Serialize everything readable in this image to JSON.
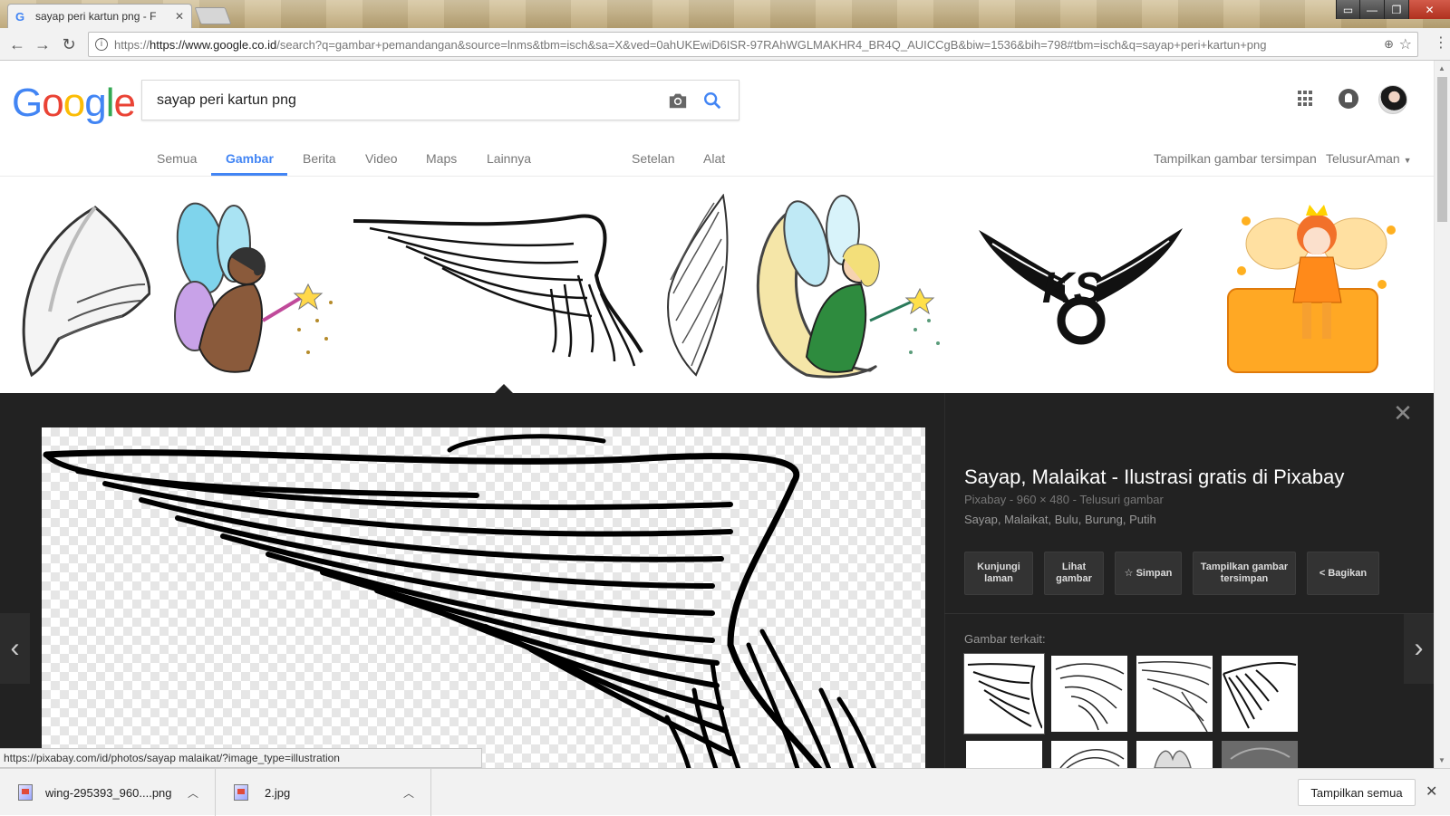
{
  "browser": {
    "tab_title": "sayap peri kartun png - F",
    "url_host": "https://www.google.co.id",
    "url_rest": "/search?q=gambar+pemandangan&source=lnms&tbm=isch&sa=X&ved=0ahUKEwiD6ISR-97RAhWGLMAKHR4_BR4Q_AUICCgB&biw=1536&bih=798#tbm=isch&q=sayap+peri+kartun+png",
    "status_url": "https://pixabay.com/id/photos/sayap malaikat/?image_type=illustration"
  },
  "search": {
    "query": "sayap peri kartun png"
  },
  "nav_tabs": {
    "all": "Semua",
    "images": "Gambar",
    "news": "Berita",
    "video": "Video",
    "maps": "Maps",
    "more": "Lainnya",
    "settings": "Setelan",
    "tools": "Alat",
    "saved": "Tampilkan gambar tersimpan",
    "safesearch": "TelusurAman"
  },
  "preview": {
    "title": "Sayap, Malaikat - Ilustrasi gratis di Pixabay",
    "meta": "Pixabay - 960 × 480 - Telusuri gambar",
    "tags": "Sayap, Malaikat, Bulu, Burung, Putih",
    "buttons": {
      "visit": "Kunjungi laman",
      "view": "Lihat gambar",
      "save": "Simpan",
      "saved": "Tampilkan gambar tersimpan",
      "share": "Bagikan"
    },
    "related_label": "Gambar terkait:"
  },
  "downloads": {
    "file1": "wing-295393_960....png",
    "file2": "2.jpg",
    "show_all": "Tampilkan semua"
  },
  "colors": {
    "google_blue": "#4285f4",
    "google_red": "#ea4335",
    "google_yellow": "#fbbc05",
    "google_green": "#34a853",
    "panel_bg": "#222222"
  }
}
